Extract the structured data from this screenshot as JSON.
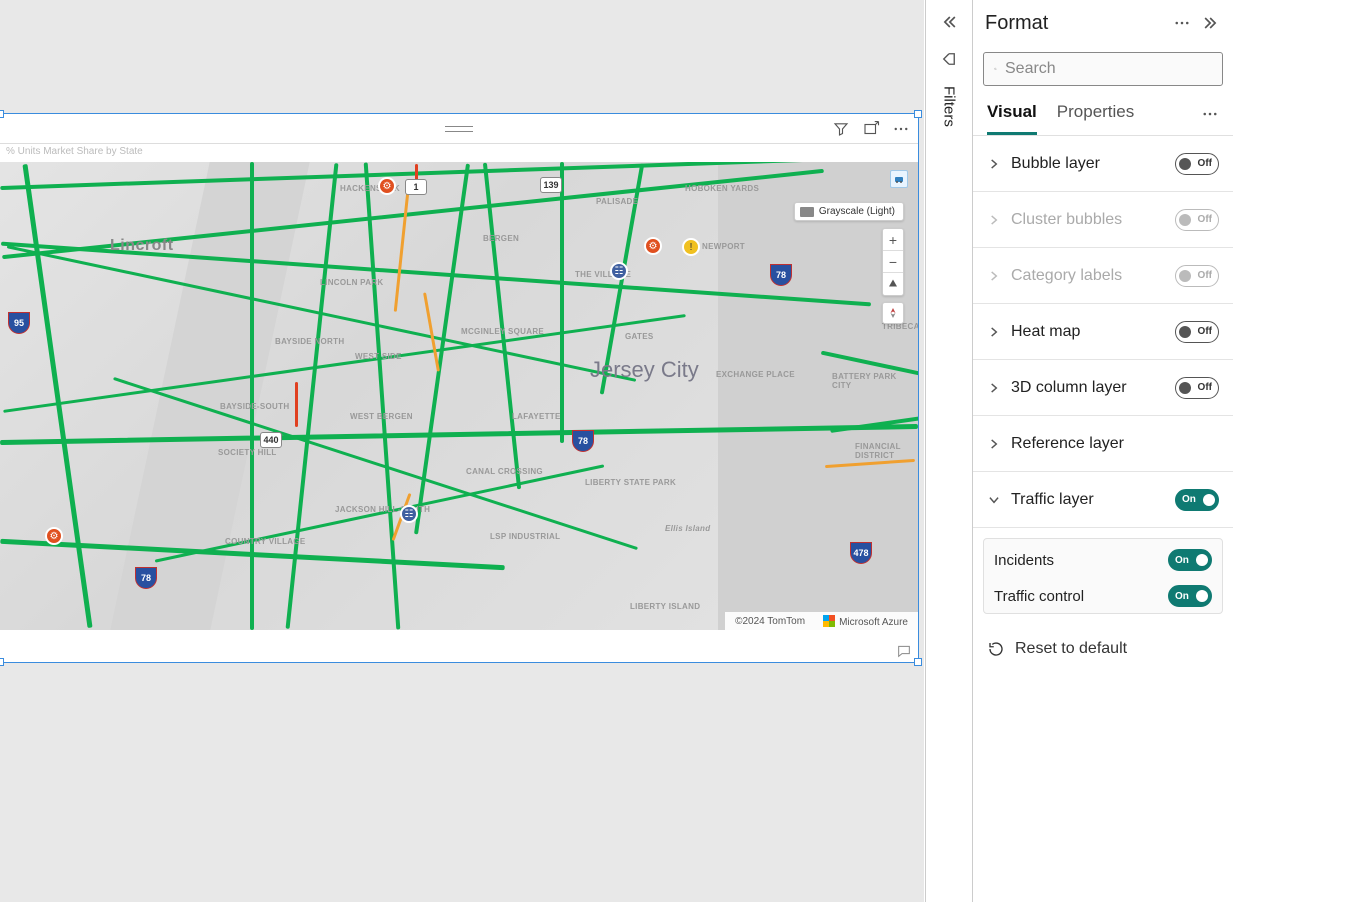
{
  "canvas": {
    "visual_title": "% Units Market Share by State",
    "map": {
      "city_label": "Jersey City",
      "style_control": "Grayscale (Light)",
      "labels": {
        "lincroft": "Lincroft",
        "lincoln_park": "LINCOLN PARK",
        "bayside_north": "BAYSIDE NORTH",
        "bayside_south": "BAYSIDE-SOUTH",
        "society_hill": "SOCIETY HILL",
        "country_village": "COUNTRY VILLAGE",
        "west_side": "WEST SIDE",
        "west_bergen": "WEST BERGEN",
        "jackson_hill": "JACKSON HILL-SOUTH",
        "mcginley": "MCGINLEY SQUARE",
        "lafayette": "LAFAYETTE",
        "canal_crossing": "CANAL CROSSING",
        "lsp_industrial": "LSP INDUSTRIAL",
        "liberty_state_park": "LIBERTY STATE PARK",
        "liberty_island": "LIBERTY ISLAND",
        "ellis_island": "Ellis Island",
        "the_village": "THE VILLAGE",
        "gates": "GATES",
        "exchange_place": "EXCHANGE PLACE",
        "newport": "NEWPORT",
        "hoboken_yards": "HOBOKEN YARDS",
        "palisade": "PALISADE",
        "hackensack": "HACKENSACK",
        "bergen": "BERGEN",
        "battery_park": "BATTERY PARK CITY",
        "financial_district": "FINANCIAL DISTRICT",
        "tribeca": "TRIBECA"
      },
      "shields": {
        "r440": "440",
        "r139": "139",
        "r1": "1",
        "i95": "95",
        "i78a": "78",
        "i78b": "78",
        "i78c": "78",
        "i478": "478"
      },
      "footer_copyright": "©2024 TomTom",
      "footer_provider": "Microsoft Azure"
    }
  },
  "filters": {
    "label": "Filters"
  },
  "format": {
    "title": "Format",
    "search_placeholder": "Search",
    "tabs": {
      "visual": "Visual",
      "properties": "Properties"
    },
    "sections": {
      "bubble": {
        "label": "Bubble layer",
        "state": "Off"
      },
      "cluster": {
        "label": "Cluster bubbles",
        "state": "Off"
      },
      "category": {
        "label": "Category labels",
        "state": "Off"
      },
      "heatmap": {
        "label": "Heat map",
        "state": "Off"
      },
      "column3d": {
        "label": "3D column layer",
        "state": "Off"
      },
      "reference": {
        "label": "Reference layer"
      },
      "traffic": {
        "label": "Traffic layer",
        "state": "On",
        "incidents": {
          "label": "Incidents",
          "state": "On"
        },
        "traffic_control": {
          "label": "Traffic control",
          "state": "On"
        }
      }
    },
    "reset": "Reset to default"
  }
}
